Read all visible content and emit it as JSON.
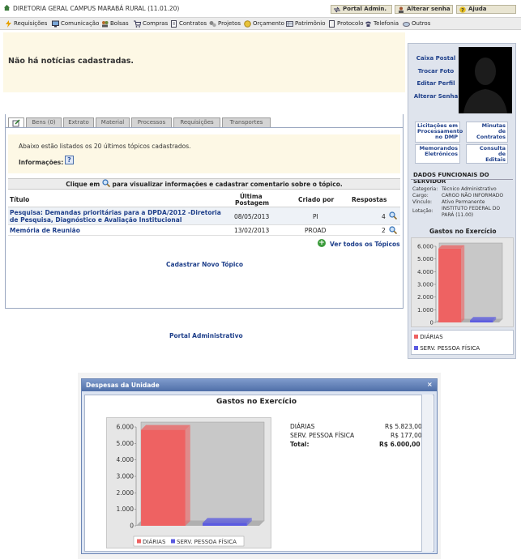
{
  "header": {
    "unit": "DIRETORIA GERAL CAMPUS MARABÁ RURAL (11.01.20)",
    "buttons": {
      "portal": "Portal Admin.",
      "senha": "Alterar senha",
      "ajuda": "Ajuda"
    }
  },
  "menu": [
    "Requisições",
    "Comunicação",
    "Bolsas",
    "Compras",
    "Contratos",
    "Projetos",
    "Orçamento",
    "Patrimônio",
    "Protocolo",
    "Telefonia",
    "Outros"
  ],
  "news": {
    "text": "Não há notícias cadastradas."
  },
  "tabs": [
    "Bens (0)",
    "Extrato",
    "Material",
    "Processos",
    "Requisições",
    "Transportes"
  ],
  "forum": {
    "intro": "Abaixo estão listados os 20 últimos tópicos cadastrados.",
    "info_label": "Informações:",
    "click_prefix": "Clique em",
    "click_suffix": "para visualizar informações e cadastrar comentario sobre o tópico.",
    "columns": {
      "title": "Título",
      "last_post_1": "Última",
      "last_post_2": "Postagem",
      "created_by": "Criado por",
      "replies": "Respostas"
    },
    "rows": [
      {
        "title_1": "Pesquisa: Demandas prioritárias para a DPDA/2012 -Diretoria",
        "title_2": "de Pesquisa, Diagnóstico e Avaliação Institucional",
        "date": "08/05/2013",
        "by": "PI",
        "replies": "4"
      },
      {
        "title_1": "Memória de Reunião",
        "title_2": "",
        "date": "13/02/2013",
        "by": "PROAD",
        "replies": "2"
      }
    ],
    "see_all": "Ver todos os Tópicos",
    "new_topic": "Cadastrar Novo Tópico"
  },
  "portal_link": "Portal Administrativo",
  "profile": {
    "links": [
      "Caixa Postal",
      "Trocar Foto",
      "Editar Perfil",
      "Alterar Senha"
    ],
    "shortcuts": {
      "licitacoes": [
        "Licitações em",
        "Processamento",
        "no DMP"
      ],
      "minutas": [
        "Minutas",
        "de",
        "Contratos"
      ],
      "memorandos": [
        "Memorandos",
        "Eletrônicos"
      ],
      "editais": [
        "Consulta",
        "de",
        "Editais"
      ]
    },
    "dados_title": "DADOS FUNCIONAIS DO SERVIDOR",
    "dados": [
      {
        "k": "Categoria:",
        "v": "Técnico Administrativo"
      },
      {
        "k": "Cargo:",
        "v": "CARGO NÃO INFORMADO"
      },
      {
        "k": "Vínculo:",
        "v": "Ativo Permanente"
      },
      {
        "k": "Lotação:",
        "v": "INSTITUTO FEDERAL DO"
      },
      {
        "k": "",
        "v": "PARÁ (11.00)"
      }
    ]
  },
  "modal": {
    "title": "Despesas da Unidade",
    "close": "×",
    "summary": [
      {
        "label": "DIÁRIAS",
        "value": "R$ 5.823,00"
      },
      {
        "label": "SERV. PESSOA FÍSICA",
        "value": "R$ 177,00"
      },
      {
        "label": "Total:",
        "value": "R$ 6.000,00"
      }
    ]
  },
  "chart_data": [
    {
      "type": "bar",
      "title": "Gastos no Exercício",
      "categories": [
        "DIÁRIAS",
        "SERV. PESSOA FÍSICA"
      ],
      "values": [
        5823,
        177
      ],
      "ylim": [
        0,
        6000
      ],
      "yticks": [
        "0",
        "1.000",
        "2.000",
        "3.000",
        "4.000",
        "5.000",
        "6.000"
      ],
      "colors": [
        "#ee6262",
        "#5a5ae0"
      ],
      "grid": false,
      "legend": "bottom"
    },
    {
      "type": "bar",
      "title": "Gastos no Exercício",
      "categories": [
        "DIÁRIAS",
        "SERV. PESSOA FÍSICA"
      ],
      "values": [
        5823,
        177
      ],
      "ylim": [
        0,
        6000
      ],
      "yticks": [
        "0",
        "1.000",
        "2.000",
        "3.000",
        "4.000",
        "5.000",
        "6.000"
      ],
      "colors": [
        "#ee6262",
        "#5a5ae0"
      ],
      "grid": false,
      "legend": "bottom"
    }
  ]
}
